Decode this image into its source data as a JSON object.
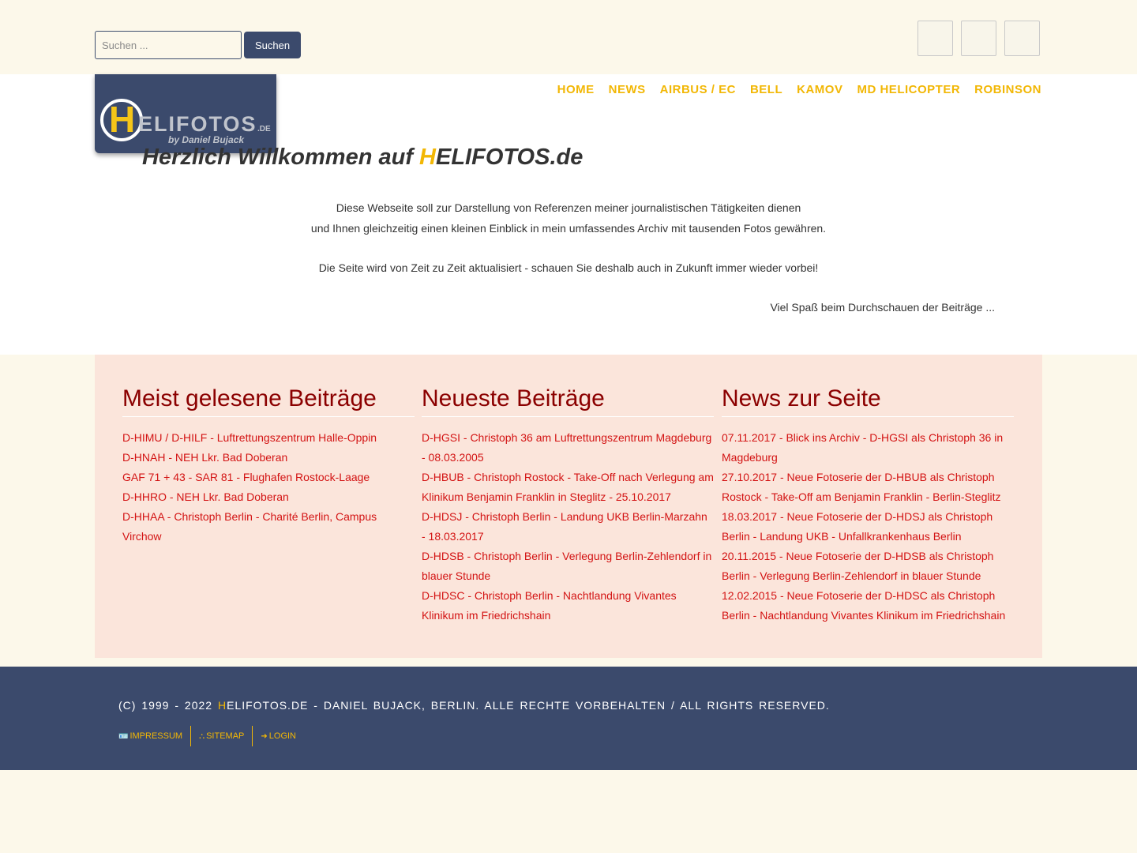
{
  "search": {
    "placeholder": "Suchen ...",
    "button_label": "Suchen"
  },
  "nav": {
    "items": [
      "Home",
      "News",
      "Airbus / EC",
      "Bell",
      "Kamov",
      "MD Helicopter",
      "Robinson"
    ]
  },
  "logo": {
    "h": "H",
    "rest": "ELIFOTOS",
    "tld": ".DE",
    "byline": "by Daniel Bujack"
  },
  "welcome": {
    "title_prefix": "Herzlich Willkommen auf ",
    "title_h": "H",
    "title_rest": "ELIFOTOS.de",
    "line1": "Diese Webseite soll zur Darstellung von Referenzen meiner journalistischen Tätigkeiten dienen",
    "line2": "und Ihnen gleichzeitig einen kleinen Einblick in mein umfassendes Archiv mit tausenden Fotos gewähren.",
    "line3": "Die Seite wird von Zeit zu Zeit aktualisiert - schauen Sie deshalb auch in Zukunft immer wieder vorbei!",
    "signoff": "Viel Spaß beim Durchschauen der Beiträge ..."
  },
  "columns": [
    {
      "title": "Meist gelesene Beiträge",
      "links": [
        "D-HIMU / D-HILF - Luftrettungszentrum Halle-Oppin",
        "D-HNAH - NEH Lkr. Bad Doberan",
        "GAF 71 + 43 - SAR 81 - Flughafen Rostock-Laage",
        "D-HHRO - NEH Lkr. Bad Doberan",
        "D-HHAA - Christoph Berlin - Charité Berlin, Campus Virchow"
      ]
    },
    {
      "title": "Neueste Beiträge",
      "links": [
        "D-HGSI - Christoph 36 am Luftrettungszentrum Magdeburg - 08.03.2005",
        "D-HBUB - Christoph Rostock - Take-Off nach Verlegung am Klinikum Benjamin Franklin in Steglitz - 25.10.2017",
        "D-HDSJ - Christoph Berlin - Landung UKB Berlin-Marzahn - 18.03.2017",
        "D-HDSB - Christoph Berlin - Verlegung Berlin-Zehlendorf in blauer Stunde",
        "D-HDSC - Christoph Berlin - Nachtlandung Vivantes Klinikum im Friedrichshain"
      ]
    },
    {
      "title": "News zur Seite",
      "links": [
        "07.11.2017 - Blick ins Archiv - D-HGSI als Christoph 36 in Magdeburg",
        "27.10.2017 - Neue Fotoserie der D-HBUB als Christoph Rostock - Take-Off am Benjamin Franklin - Berlin-Steglitz",
        "18.03.2017 - Neue Fotoserie der D-HDSJ als Christoph Berlin - Landung UKB - Unfallkrankenhaus Berlin",
        "20.11.2015 - Neue Fotoserie der D-HDSB als Christoph Berlin - Verlegung Berlin-Zehlendorf in blauer Stunde",
        "12.02.2015 - Neue Fotoserie der D-HDSC als Christoph Berlin - Nachtlandung Vivantes Klinikum im Friedrichshain"
      ]
    }
  ],
  "footer": {
    "copyright_prefix": "(C) 1999 - 2022 ",
    "copyright_h": "H",
    "copyright_rest": "ELIFOTOS.DE - DANIEL BUJACK, BERLIN. ALLE RECHTE VORBEHALTEN / ALL RIGHTS RESERVED.",
    "links": [
      "Impressum",
      "Sitemap",
      "Login"
    ]
  },
  "colors": {
    "accent": "#f2b705",
    "navy": "#3b4a6c",
    "panel": "#fbe5db",
    "link": "#d31313",
    "heading": "#8b0000",
    "page_bg": "#fcf8ea"
  },
  "icons": [
    "id-card-icon",
    "sitemap-icon",
    "login-icon"
  ]
}
